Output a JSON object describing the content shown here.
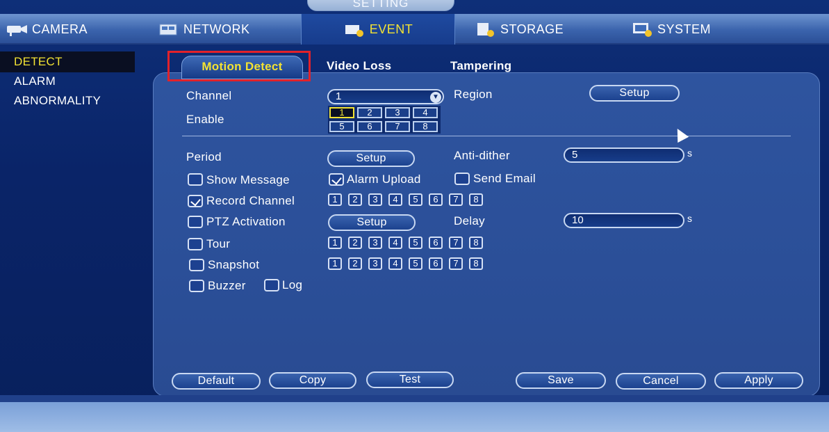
{
  "window": {
    "title": "SETTING"
  },
  "main_nav": [
    {
      "label": "CAMERA",
      "icon": "camera-icon"
    },
    {
      "label": "NETWORK",
      "icon": "network-icon"
    },
    {
      "label": "EVENT",
      "icon": "event-icon"
    },
    {
      "label": "STORAGE",
      "icon": "storage-icon"
    },
    {
      "label": "SYSTEM",
      "icon": "system-icon"
    }
  ],
  "sidebar": {
    "items": [
      {
        "label": "DETECT"
      },
      {
        "label": "ALARM"
      },
      {
        "label": "ABNORMALITY"
      }
    ]
  },
  "subtabs": [
    {
      "label": "Motion Detect"
    },
    {
      "label": "Video Loss"
    },
    {
      "label": "Tampering"
    }
  ],
  "form": {
    "channel_label": "Channel",
    "channel_value": "1",
    "enable_label": "Enable",
    "channel_grid": [
      "1",
      "2",
      "3",
      "4",
      "5",
      "6",
      "7",
      "8"
    ],
    "region_label": "Region",
    "setup_label": "Setup",
    "period_label": "Period",
    "anti_dither_label": "Anti-dither",
    "anti_dither_value": "5",
    "unit_s": "s",
    "show_message_label": "Show Message",
    "alarm_upload_label": "Alarm Upload",
    "send_email_label": "Send Email",
    "record_channel_label": "Record Channel",
    "ptz_activation_label": "PTZ Activation",
    "delay_label": "Delay",
    "delay_value": "10",
    "tour_label": "Tour",
    "snapshot_label": "Snapshot",
    "buzzer_label": "Buzzer",
    "log_label": "Log",
    "channel_numbers": [
      "1",
      "2",
      "3",
      "4",
      "5",
      "6",
      "7",
      "8"
    ]
  },
  "buttons": {
    "default": "Default",
    "copy": "Copy",
    "test": "Test",
    "save": "Save",
    "cancel": "Cancel",
    "apply": "Apply"
  }
}
